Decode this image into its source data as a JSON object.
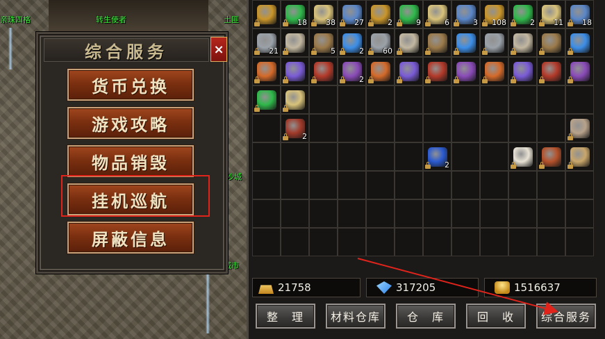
{
  "world": {
    "labels": [
      "亲珠四格",
      "转生使者",
      "土匪",
      "沙城",
      "城市"
    ]
  },
  "dialog": {
    "title": "综合服务",
    "close_icon": "×",
    "buttons": [
      "货币兑换",
      "游戏攻略",
      "物品销毁",
      "挂机巡航",
      "屏蔽信息"
    ],
    "highlighted_index": 3
  },
  "inventory": {
    "row0_counts": [
      "",
      "18",
      "38",
      "27",
      "2",
      "9",
      "6",
      "3",
      "108",
      "2",
      "11",
      "18"
    ],
    "row1_counts": [
      "21",
      "",
      "5",
      "2",
      "60",
      "",
      "",
      "",
      "",
      "",
      "",
      ""
    ],
    "row2_counts": [
      "",
      "",
      "",
      "2",
      "",
      "",
      "",
      "",
      "",
      "",
      "",
      ""
    ],
    "orb_count_1": "2",
    "orb_count_2": "2"
  },
  "currency": {
    "gold": "21758",
    "diamond": "317205",
    "coins": "1516637"
  },
  "actions": {
    "sort": "整　理",
    "material_storage": "材料仓库",
    "storage": "仓　库",
    "recycle": "回　收",
    "service": "综合服务"
  },
  "colors": {
    "highlight": "#e0241b",
    "arrow": "#e0241b",
    "npc_label": "#3ef03e"
  }
}
